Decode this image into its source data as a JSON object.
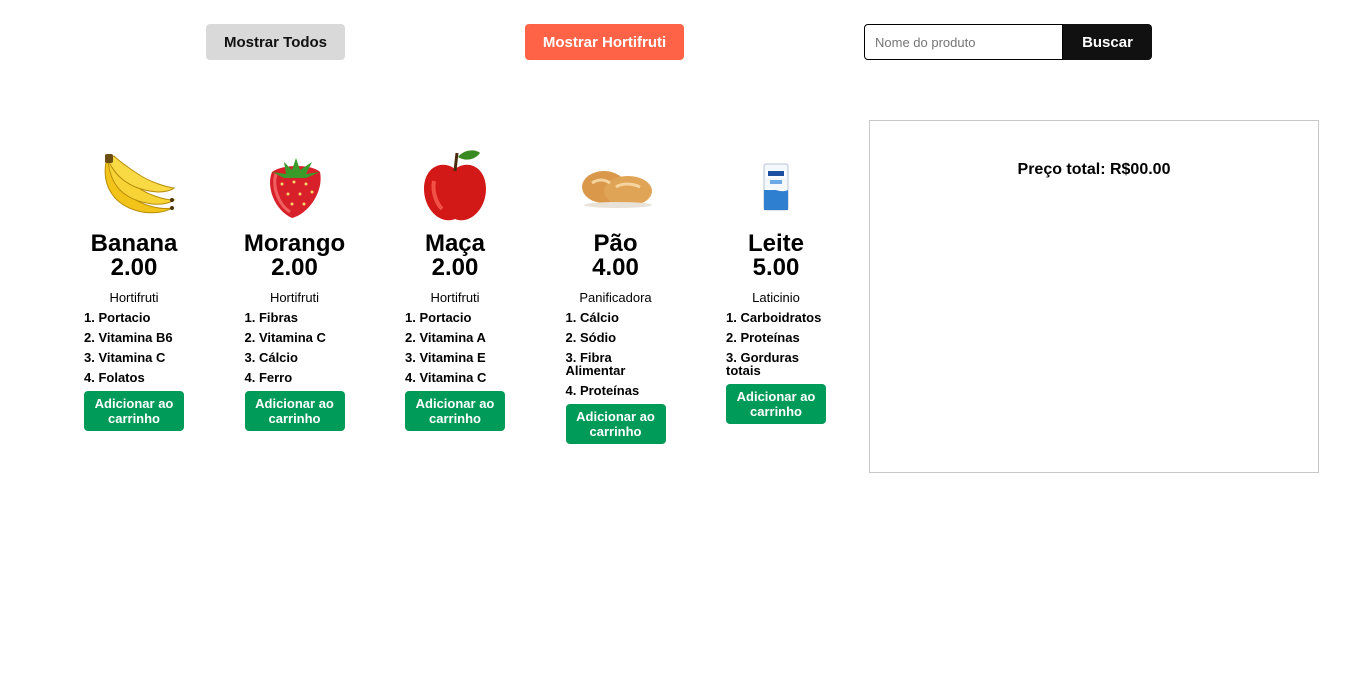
{
  "toolbar": {
    "show_all_label": "Mostrar Todos",
    "show_hortifruti_label": "Mostrar Hortifruti",
    "search_placeholder": "Nome do produto",
    "search_button_label": "Buscar"
  },
  "products": [
    {
      "name": "Banana",
      "price": "2.00",
      "category": "Hortifruti",
      "icon": "banana-icon",
      "nutrients": [
        "1. Portacio",
        "2. Vitamina B6",
        "3. Vitamina C",
        "4. Folatos"
      ],
      "button": "Adicionar ao carrinho"
    },
    {
      "name": "Morango",
      "price": "2.00",
      "category": "Hortifruti",
      "icon": "strawberry-icon",
      "nutrients": [
        "1. Fibras",
        "2. Vitamina C",
        "3. Cálcio",
        "4. Ferro"
      ],
      "button": "Adicionar ao carrinho"
    },
    {
      "name": "Maça",
      "price": "2.00",
      "category": "Hortifruti",
      "icon": "apple-icon",
      "nutrients": [
        "1. Portacio",
        "2. Vitamina A",
        "3. Vitamina E",
        "4. Vitamina C"
      ],
      "button": "Adicionar ao carrinho"
    },
    {
      "name": "Pão",
      "price": "4.00",
      "category": "Panificadora",
      "icon": "bread-icon",
      "nutrients": [
        "1. Cálcio",
        "2. Sódio",
        "3. Fibra Alimentar",
        "4. Proteínas"
      ],
      "button": "Adicionar ao carrinho"
    },
    {
      "name": "Leite",
      "price": "5.00",
      "category": "Laticinio",
      "icon": "milk-carton-icon",
      "nutrients": [
        "1. Carboidratos",
        "2. Proteínas",
        "3. Gorduras totais"
      ],
      "button": "Adicionar ao carrinho"
    }
  ],
  "cart": {
    "total_label": "Preço total: R$00.00"
  },
  "colors": {
    "hortifruti_button": "#ff6347",
    "add_button": "#009b59",
    "search_button": "#111111",
    "show_all_button": "#d9d9d9"
  }
}
